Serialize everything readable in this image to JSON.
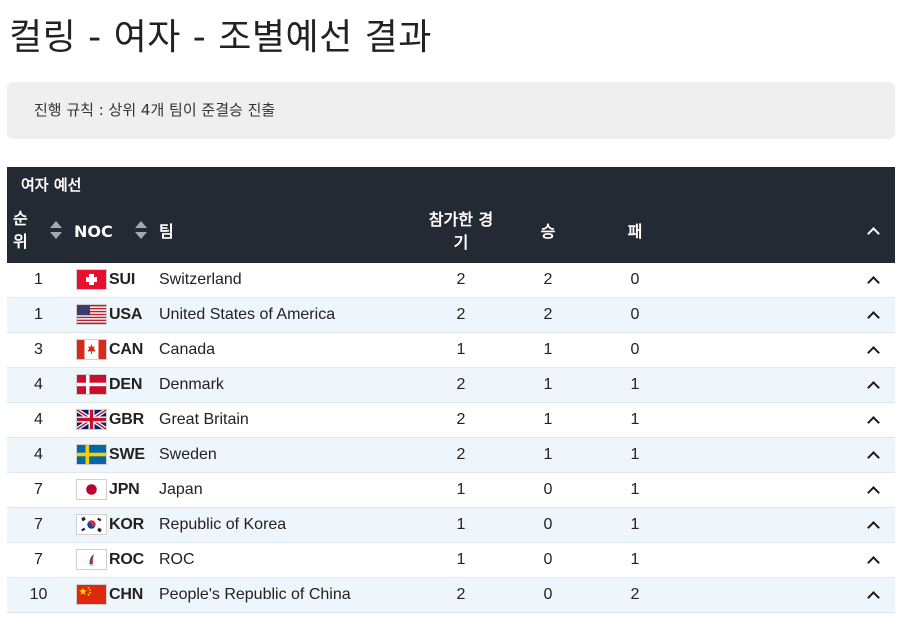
{
  "page": {
    "title": "컬링 - 여자 - 조별예선 결과",
    "rule": "진행 규칙 : 상위 4개 팀이 준결승 진출"
  },
  "table": {
    "group_title": "여자 예선",
    "columns": {
      "rank": "순\n위",
      "noc": "NOC",
      "team": "팀",
      "played": "참가한 경\n기",
      "won": "승",
      "lost": "패"
    },
    "rows": [
      {
        "rank": "1",
        "noc": "SUI",
        "team": "Switzerland",
        "played": "2",
        "won": "2",
        "lost": "0",
        "flag": "switzerland-flag"
      },
      {
        "rank": "1",
        "noc": "USA",
        "team": "United States of America",
        "played": "2",
        "won": "2",
        "lost": "0",
        "flag": "usa-flag"
      },
      {
        "rank": "3",
        "noc": "CAN",
        "team": "Canada",
        "played": "1",
        "won": "1",
        "lost": "0",
        "flag": "canada-flag"
      },
      {
        "rank": "4",
        "noc": "DEN",
        "team": "Denmark",
        "played": "2",
        "won": "1",
        "lost": "1",
        "flag": "denmark-flag"
      },
      {
        "rank": "4",
        "noc": "GBR",
        "team": "Great Britain",
        "played": "2",
        "won": "1",
        "lost": "1",
        "flag": "great-britain-flag"
      },
      {
        "rank": "4",
        "noc": "SWE",
        "team": "Sweden",
        "played": "2",
        "won": "1",
        "lost": "1",
        "flag": "sweden-flag"
      },
      {
        "rank": "7",
        "noc": "JPN",
        "team": "Japan",
        "played": "1",
        "won": "0",
        "lost": "1",
        "flag": "japan-flag"
      },
      {
        "rank": "7",
        "noc": "KOR",
        "team": "Republic of Korea",
        "played": "1",
        "won": "0",
        "lost": "1",
        "flag": "korea-flag"
      },
      {
        "rank": "7",
        "noc": "ROC",
        "team": "ROC",
        "played": "1",
        "won": "0",
        "lost": "1",
        "flag": "roc-flag"
      },
      {
        "rank": "10",
        "noc": "CHN",
        "team": "People's Republic of China",
        "played": "2",
        "won": "0",
        "lost": "2",
        "flag": "china-flag"
      }
    ]
  },
  "colors": {
    "header_bg": "#232a33",
    "row_alt_bg": "#eef6fc",
    "rule_box_bg": "#efefef"
  }
}
